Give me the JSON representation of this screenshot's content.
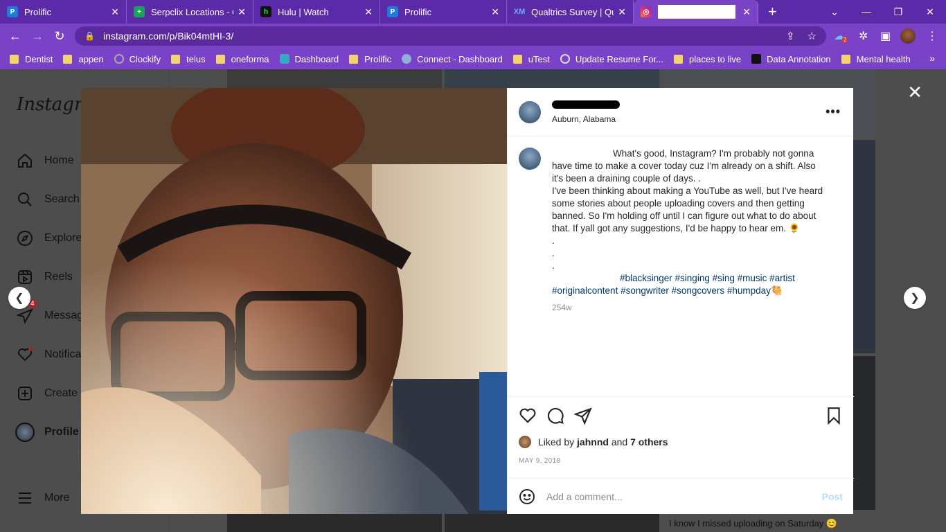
{
  "browser": {
    "tabs": [
      {
        "title": "Prolific",
        "color": "#1f7ae0"
      },
      {
        "title": "Serpclix Locations - Go",
        "color": "#18a35a"
      },
      {
        "title": "Hulu | Watch",
        "color": "#1ce783"
      },
      {
        "title": "Prolific",
        "color": "#1f7ae0"
      },
      {
        "title": "Qualtrics Survey | Qua",
        "color": "#0e5ec9"
      },
      {
        "title": "",
        "color": "#d62976"
      }
    ],
    "url": "instagram.com/p/Bik04mtHI-3/",
    "extension_badge": "2",
    "bookmarks": [
      {
        "label": "Dentist",
        "kind": "folder"
      },
      {
        "label": "appen",
        "kind": "folder"
      },
      {
        "label": "Clockify",
        "kind": "site"
      },
      {
        "label": "telus",
        "kind": "folder"
      },
      {
        "label": "oneforma",
        "kind": "folder"
      },
      {
        "label": "Dashboard",
        "kind": "site"
      },
      {
        "label": "Prolific",
        "kind": "folder"
      },
      {
        "label": "Connect - Dashboard",
        "kind": "site"
      },
      {
        "label": "uTest",
        "kind": "folder"
      },
      {
        "label": "Update Resume For...",
        "kind": "site"
      },
      {
        "label": "places to live",
        "kind": "folder"
      },
      {
        "label": "Data Annotation",
        "kind": "site"
      },
      {
        "label": "Mental health",
        "kind": "folder"
      }
    ]
  },
  "sidebar": {
    "logo": "Instagram",
    "items": [
      {
        "label": "Home",
        "icon": "home-icon"
      },
      {
        "label": "Search",
        "icon": "search-icon"
      },
      {
        "label": "Explore",
        "icon": "compass-icon"
      },
      {
        "label": "Reels",
        "icon": "reels-icon"
      },
      {
        "label": "Messages",
        "icon": "messenger-icon",
        "badge": "4"
      },
      {
        "label": "Notifications",
        "icon": "heart-icon"
      },
      {
        "label": "Create",
        "icon": "plus-square-icon"
      },
      {
        "label": "Profile",
        "icon": "profile-avatar"
      },
      {
        "label": "More",
        "icon": "menu-icon"
      }
    ]
  },
  "background_text": "I know I missed uploading on Saturday 😊",
  "post": {
    "location": "Auburn, Alabama",
    "caption": "What's good, Instagram? I'm probably not gonna have time to make a cover today cuz I'm already on a shift. Also it's been a draining couple of days. .\nI've been thinking about making a YouTube as well, but I've heard some stories about people uploading covers and then getting banned. So I'm holding off until I can figure out what to do about that. If yall got any suggestions, I'd be happy to hear em. 🌻\n.\n.\n.",
    "hashtags": "#blacksinger #singing #sing #music #artist #originalcontent #songwriter #songcovers #humpday🐫",
    "time_ago": "254w",
    "liked_by_prefix": "Liked by",
    "liked_by_user": "jahnnd",
    "liked_by_and": "and",
    "liked_by_others": "7 others",
    "date": "MAY 9, 2018",
    "comment_placeholder": "Add a comment...",
    "post_button": "Post"
  }
}
